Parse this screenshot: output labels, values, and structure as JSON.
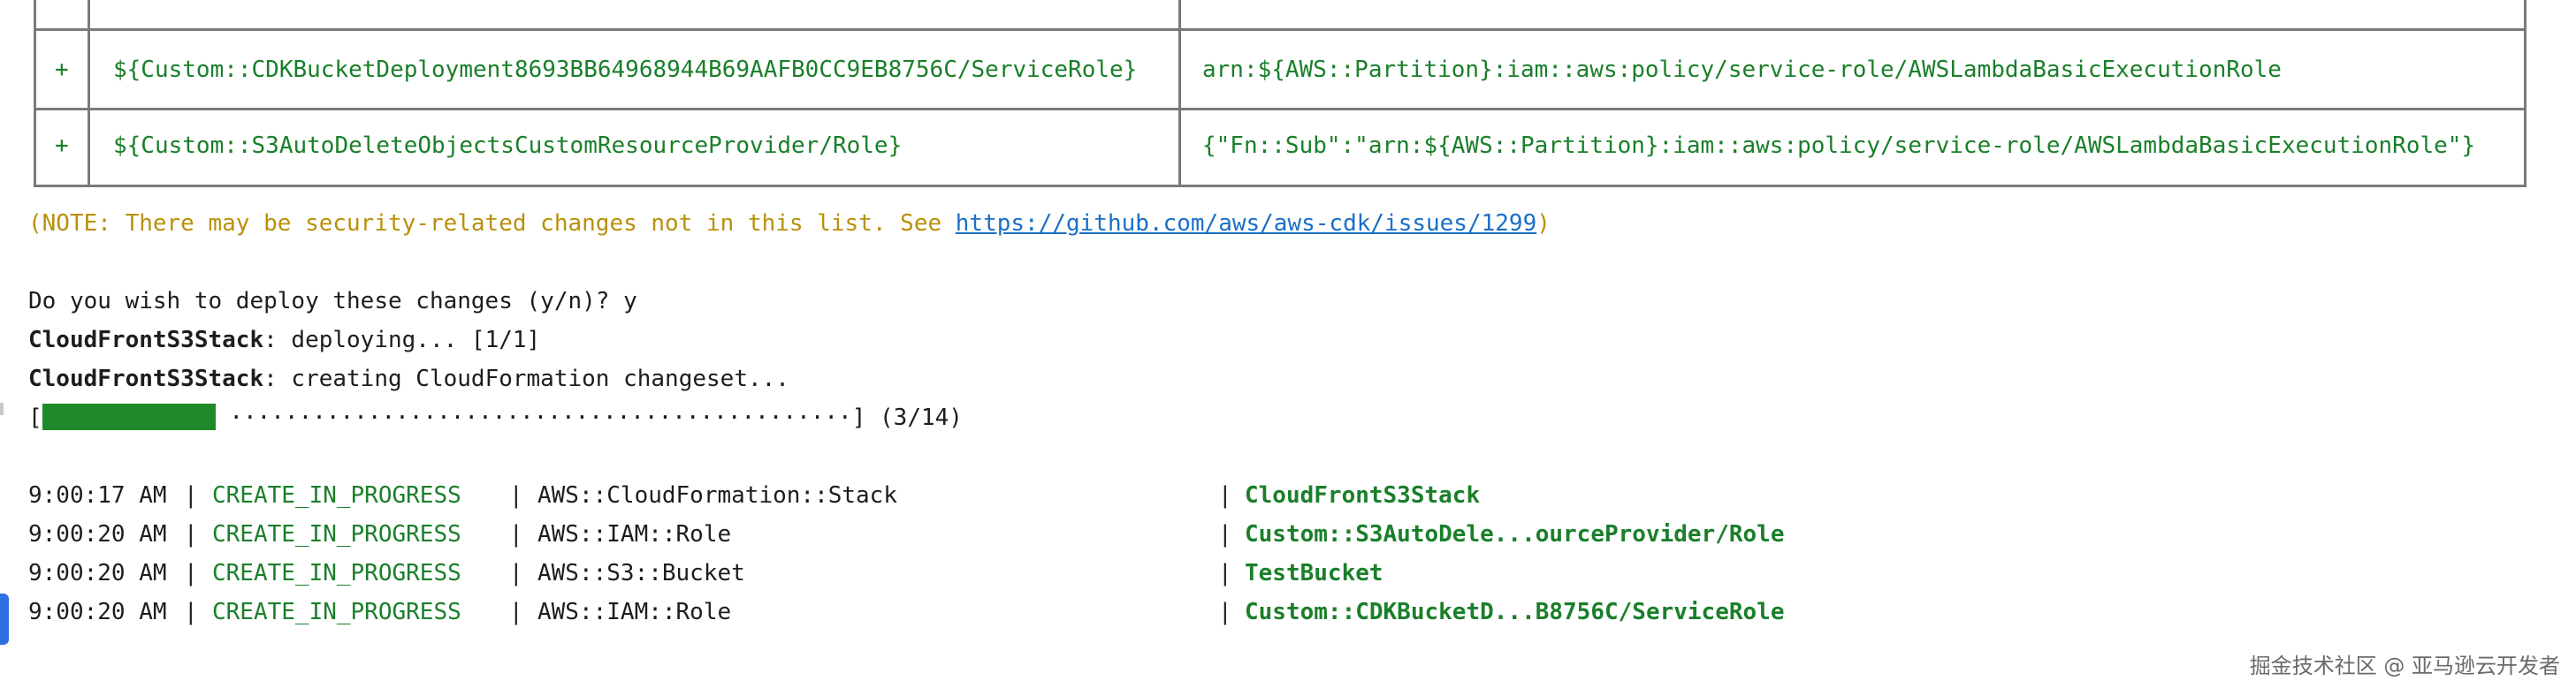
{
  "table": {
    "top_partial_right": "—————— ——  ——",
    "rows": [
      {
        "change": "+",
        "resource": "${Custom::CDKBucketDeployment8693BB64968944B69AAFB0CC9EB8756C/ServiceRole}",
        "policy": "arn:${AWS::Partition}:iam::aws:policy/service-role/AWSLambdaBasicExecutionRole"
      },
      {
        "change": "+",
        "resource": "${Custom::S3AutoDeleteObjectsCustomResourceProvider/Role}",
        "policy": "{\"Fn::Sub\":\"arn:${AWS::Partition}:iam::aws:policy/service-role/AWSLambdaBasicExecutionRole\"}"
      }
    ]
  },
  "note": {
    "prefix": "(NOTE: There may be security-related changes not in this list. See ",
    "link": "https://github.com/aws/aws-cdk/issues/1299",
    "suffix": ")"
  },
  "prompt": "Do you wish to deploy these changes (y/n)? y",
  "deploy_lines": [
    {
      "stack": "CloudFrontS3Stack",
      "text": ": deploying... [1/1]"
    },
    {
      "stack": "CloudFrontS3Stack",
      "text": ": creating CloudFormation changeset..."
    }
  ],
  "progress": {
    "open": "[",
    "dots": "·············································",
    "close": "] (3/14)",
    "fraction": 0.2143
  },
  "events": [
    {
      "time": "9:00:17 AM",
      "status": "CREATE_IN_PROGRESS",
      "type": "AWS::CloudFormation::Stack",
      "logical": "CloudFrontS3Stack"
    },
    {
      "time": "9:00:20 AM",
      "status": "CREATE_IN_PROGRESS",
      "type": "AWS::IAM::Role",
      "logical": "Custom::S3AutoDele...ourceProvider/Role"
    },
    {
      "time": "9:00:20 AM",
      "status": "CREATE_IN_PROGRESS",
      "type": "AWS::S3::Bucket",
      "logical": "TestBucket"
    },
    {
      "time": "9:00:20 AM",
      "status": "CREATE_IN_PROGRESS",
      "type": "AWS::IAM::Role",
      "logical": "Custom::CDKBucketD...B8756C/ServiceRole"
    }
  ],
  "watermark": "掘金技术社区 @ 亚马逊云开发者",
  "colors": {
    "green": "#1a7f2a",
    "note": "#b8900a",
    "link": "#1a6fc6",
    "progress": "#1e8a2a"
  }
}
